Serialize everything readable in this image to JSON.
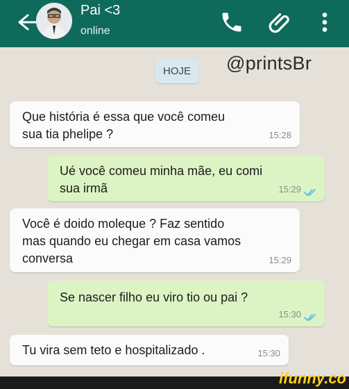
{
  "header": {
    "contact_name": "Pai <3",
    "status": "online",
    "colors": {
      "bar": "#0e6a5b"
    },
    "icons": [
      "back-arrow-icon",
      "phone-icon",
      "paperclip-icon",
      "more-vert-icon"
    ]
  },
  "chat": {
    "date_chip": "HOJE",
    "watermark": "@printsBr",
    "messages": [
      {
        "direction": "in",
        "text": "Que história é essa que você comeu\nsua tia phelipe ?",
        "time": "15:28"
      },
      {
        "direction": "out",
        "text": "Ué você comeu minha mãe, eu comi\nsua irmã",
        "time": "15:29",
        "status": "read"
      },
      {
        "direction": "in",
        "text": "Você é doido moleque ? Faz sentido\nmas quando eu chegar em casa vamos\nconversa",
        "time": "15:29"
      },
      {
        "direction": "out",
        "text": "Se nascer filho eu viro tio ou pai ?",
        "time": "15:30",
        "status": "read"
      },
      {
        "direction": "in",
        "text": "Tu vira sem teto e hospitalizado .",
        "time": "15:30"
      }
    ]
  },
  "footer": {
    "brand": "ifunny.co"
  }
}
